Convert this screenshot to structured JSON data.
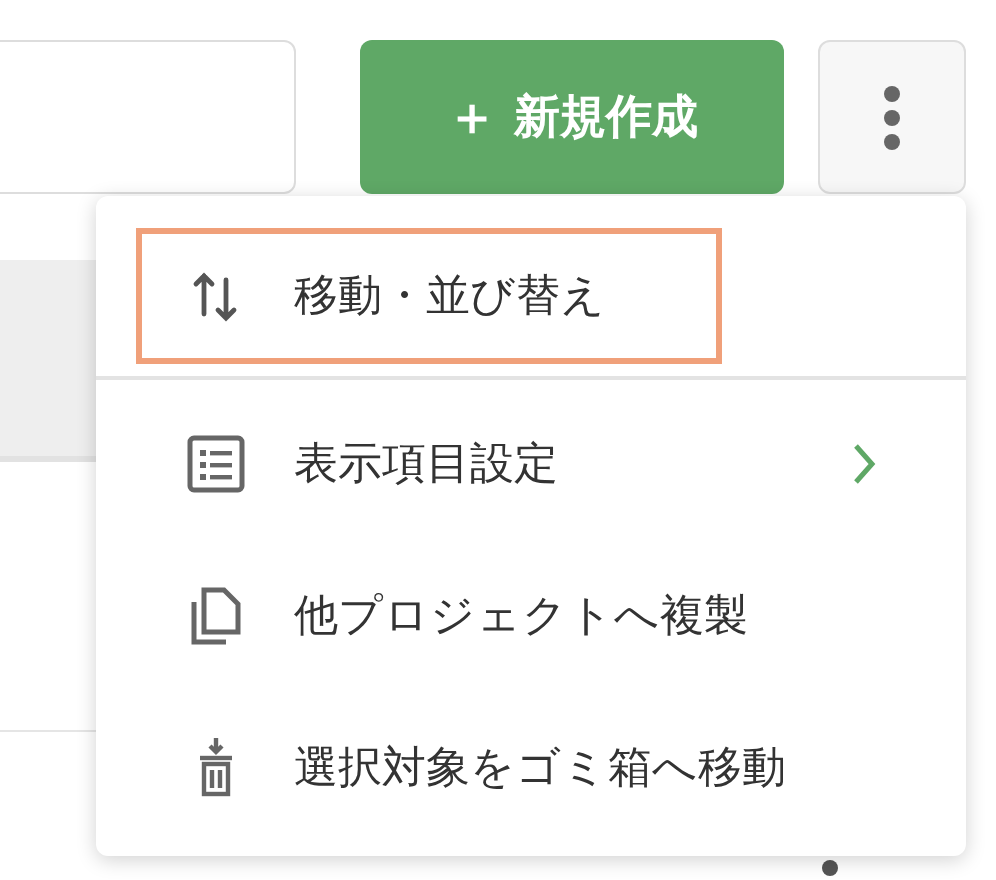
{
  "toolbar": {
    "new_button": {
      "icon": "＋",
      "label": "新規作成"
    }
  },
  "menu": {
    "sections": [
      {
        "items": [
          {
            "label": "移動・並び替え",
            "highlighted": true,
            "submenu": false
          }
        ]
      },
      {
        "items": [
          {
            "label": "表示項目設定",
            "highlighted": false,
            "submenu": true
          },
          {
            "label": "他プロジェクトへ複製",
            "highlighted": false,
            "submenu": false
          },
          {
            "label": "選択対象をゴミ箱へ移動",
            "highlighted": false,
            "submenu": false
          }
        ]
      }
    ]
  }
}
